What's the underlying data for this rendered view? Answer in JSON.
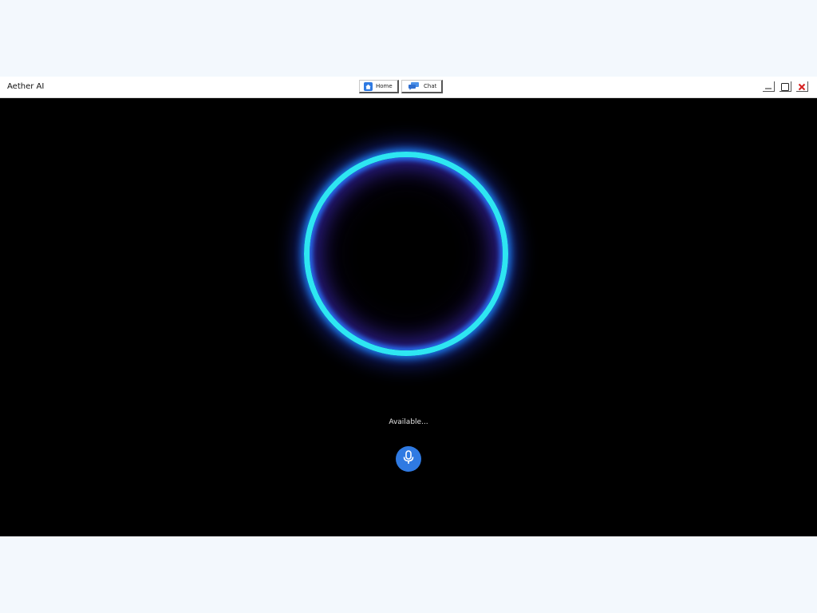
{
  "window": {
    "title": "Aether AI"
  },
  "nav": {
    "home_label": "Home",
    "home_icon": "home-icon",
    "chat_label": "Chat",
    "chat_icon": "chat-bubbles-icon"
  },
  "controls": {
    "minimize_icon": "minimize-icon",
    "maximize_icon": "maximize-icon",
    "close_icon": "close-icon",
    "close_color": "#d62020"
  },
  "assistant": {
    "status": "Available...",
    "ring_color": "#2ee6f2",
    "mic_icon": "microphone-icon",
    "mic_color": "#2f7ae2"
  }
}
